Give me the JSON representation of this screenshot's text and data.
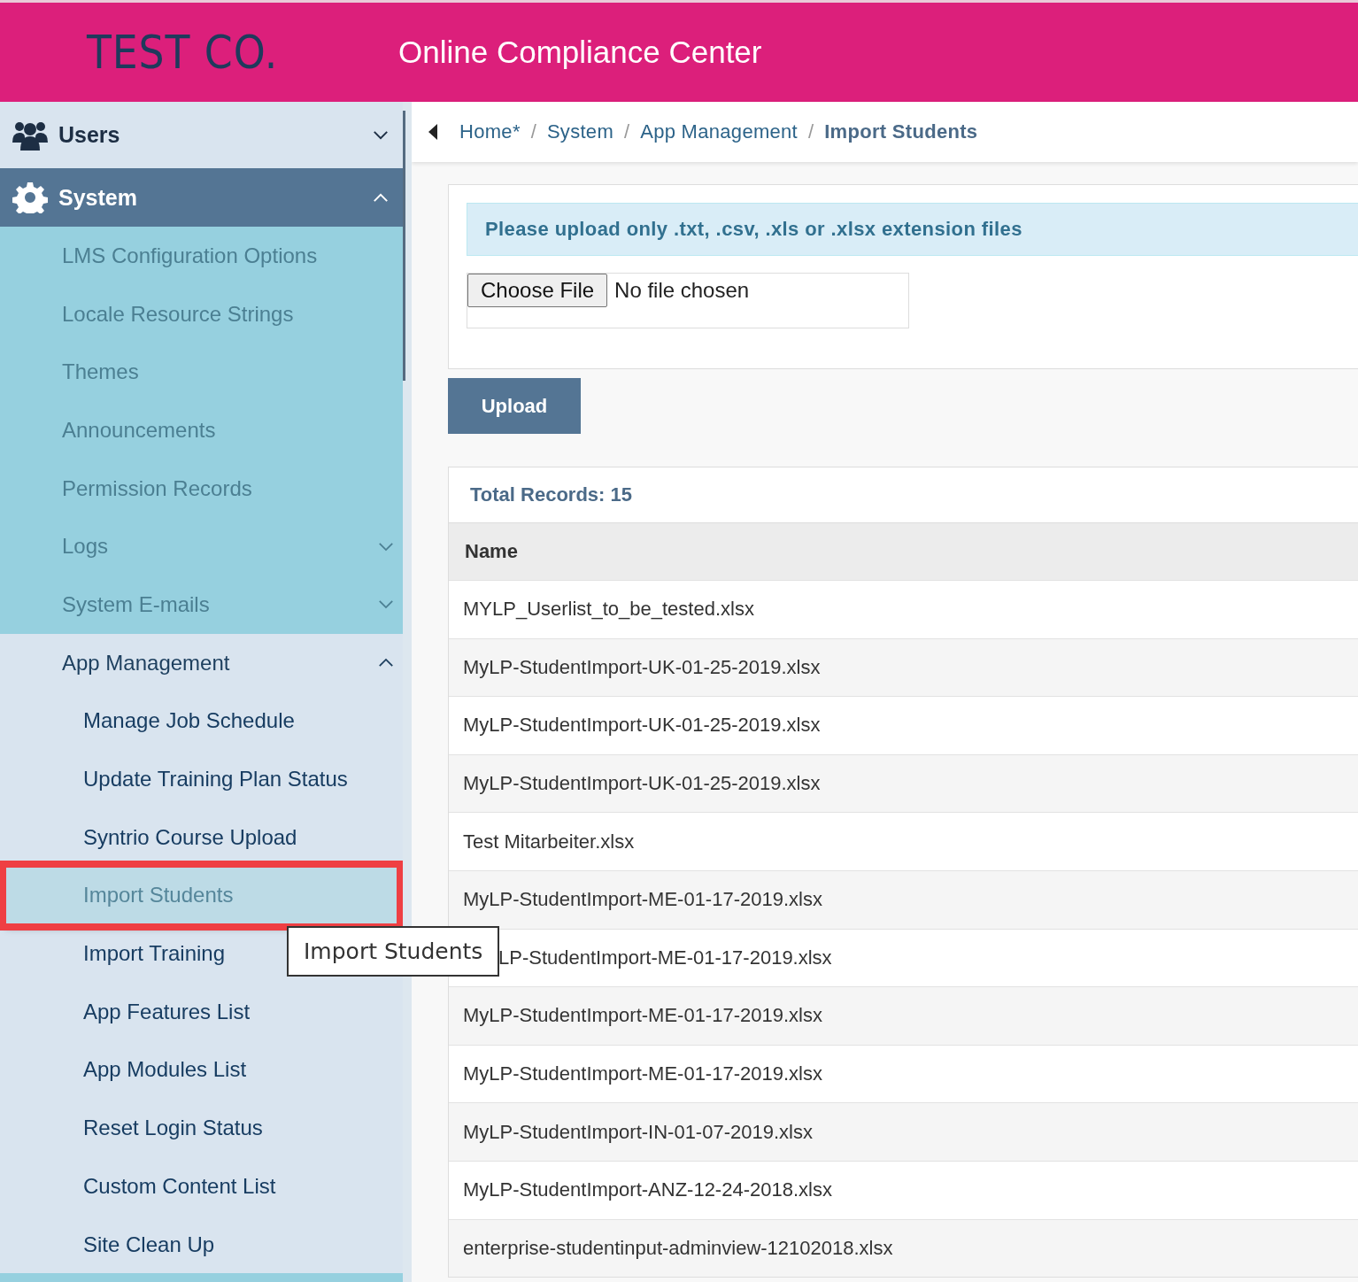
{
  "header": {
    "logo": "TEST CO.",
    "title": "Online Compliance Center"
  },
  "sidebar": {
    "sections": [
      {
        "label": "Users",
        "kind": "people",
        "expanded": false
      },
      {
        "label": "System",
        "kind": "settings",
        "expanded": true,
        "items": [
          {
            "label": "LMS Configuration Options",
            "selected": false
          },
          {
            "label": "Locale Resource Strings",
            "selected": false
          },
          {
            "label": "Themes",
            "selected": false
          },
          {
            "label": "Announcements",
            "selected": false
          },
          {
            "label": "Permission Records",
            "selected": false
          },
          {
            "label": "Logs",
            "selected": false,
            "expanded": false
          },
          {
            "label": "System E-mails",
            "selected": false,
            "expanded": false
          },
          {
            "label": "App Management",
            "selected": false,
            "expanded": true,
            "children": [
              {
                "label": "Manage Job Schedule",
                "selected": false
              },
              {
                "label": "Update Training Plan Status",
                "selected": false
              },
              {
                "label": "Syntrio Course Upload",
                "selected": false
              },
              {
                "label": "Import Students",
                "selected": true
              },
              {
                "label": "Import Training",
                "selected": false
              },
              {
                "label": "App Features List",
                "selected": false
              },
              {
                "label": "App Modules List",
                "selected": false
              },
              {
                "label": "Reset Login Status",
                "selected": false
              },
              {
                "label": "Custom Content List",
                "selected": false
              },
              {
                "label": "Site Clean Up",
                "selected": false
              }
            ]
          }
        ]
      }
    ]
  },
  "tooltip": {
    "text": "Import Students"
  },
  "breadcrumb_separator": "/",
  "breadcrumb": [
    {
      "label": "Home*",
      "current": false
    },
    {
      "label": "System",
      "current": false
    },
    {
      "label": "App Management",
      "current": false
    },
    {
      "label": "Import Students",
      "current": true
    }
  ],
  "upload": {
    "notice": "Please upload only .txt, .csv, .xls or .xlsx extension files",
    "file_button": "Choose File",
    "file_status": "No file chosen",
    "submit": "Upload"
  },
  "records": {
    "total": "Total Records: 15",
    "columns": [
      "Name"
    ],
    "rows": [
      {
        "name": "MYLP_Userlist_to_be_tested.xlsx",
        "covered": false
      },
      {
        "name": "MyLP-StudentImport-UK-01-25-2019.xlsx",
        "covered": false
      },
      {
        "name": "MyLP-StudentImport-UK-01-25-2019.xlsx",
        "covered": false
      },
      {
        "name": "MyLP-StudentImport-UK-01-25-2019.xlsx",
        "covered": false
      },
      {
        "name": "Test Mitarbeiter.xlsx",
        "covered": false
      },
      {
        "name": "MyLP-StudentImport-ME-01-17-2019.xlsx",
        "covered": false
      },
      {
        "name": "LP-StudentImport-ME-01-17-2019.xlsx",
        "covered": true
      },
      {
        "name": "MyLP-StudentImport-ME-01-17-2019.xlsx",
        "covered": false
      },
      {
        "name": "MyLP-StudentImport-ME-01-17-2019.xlsx",
        "covered": false
      },
      {
        "name": "MyLP-StudentImport-IN-01-07-2019.xlsx",
        "covered": false
      },
      {
        "name": "MyLP-StudentImport-ANZ-12-24-2018.xlsx",
        "covered": false
      },
      {
        "name": "enterprise-studentinput-adminview-12102018.xlsx",
        "covered": false
      }
    ]
  }
}
